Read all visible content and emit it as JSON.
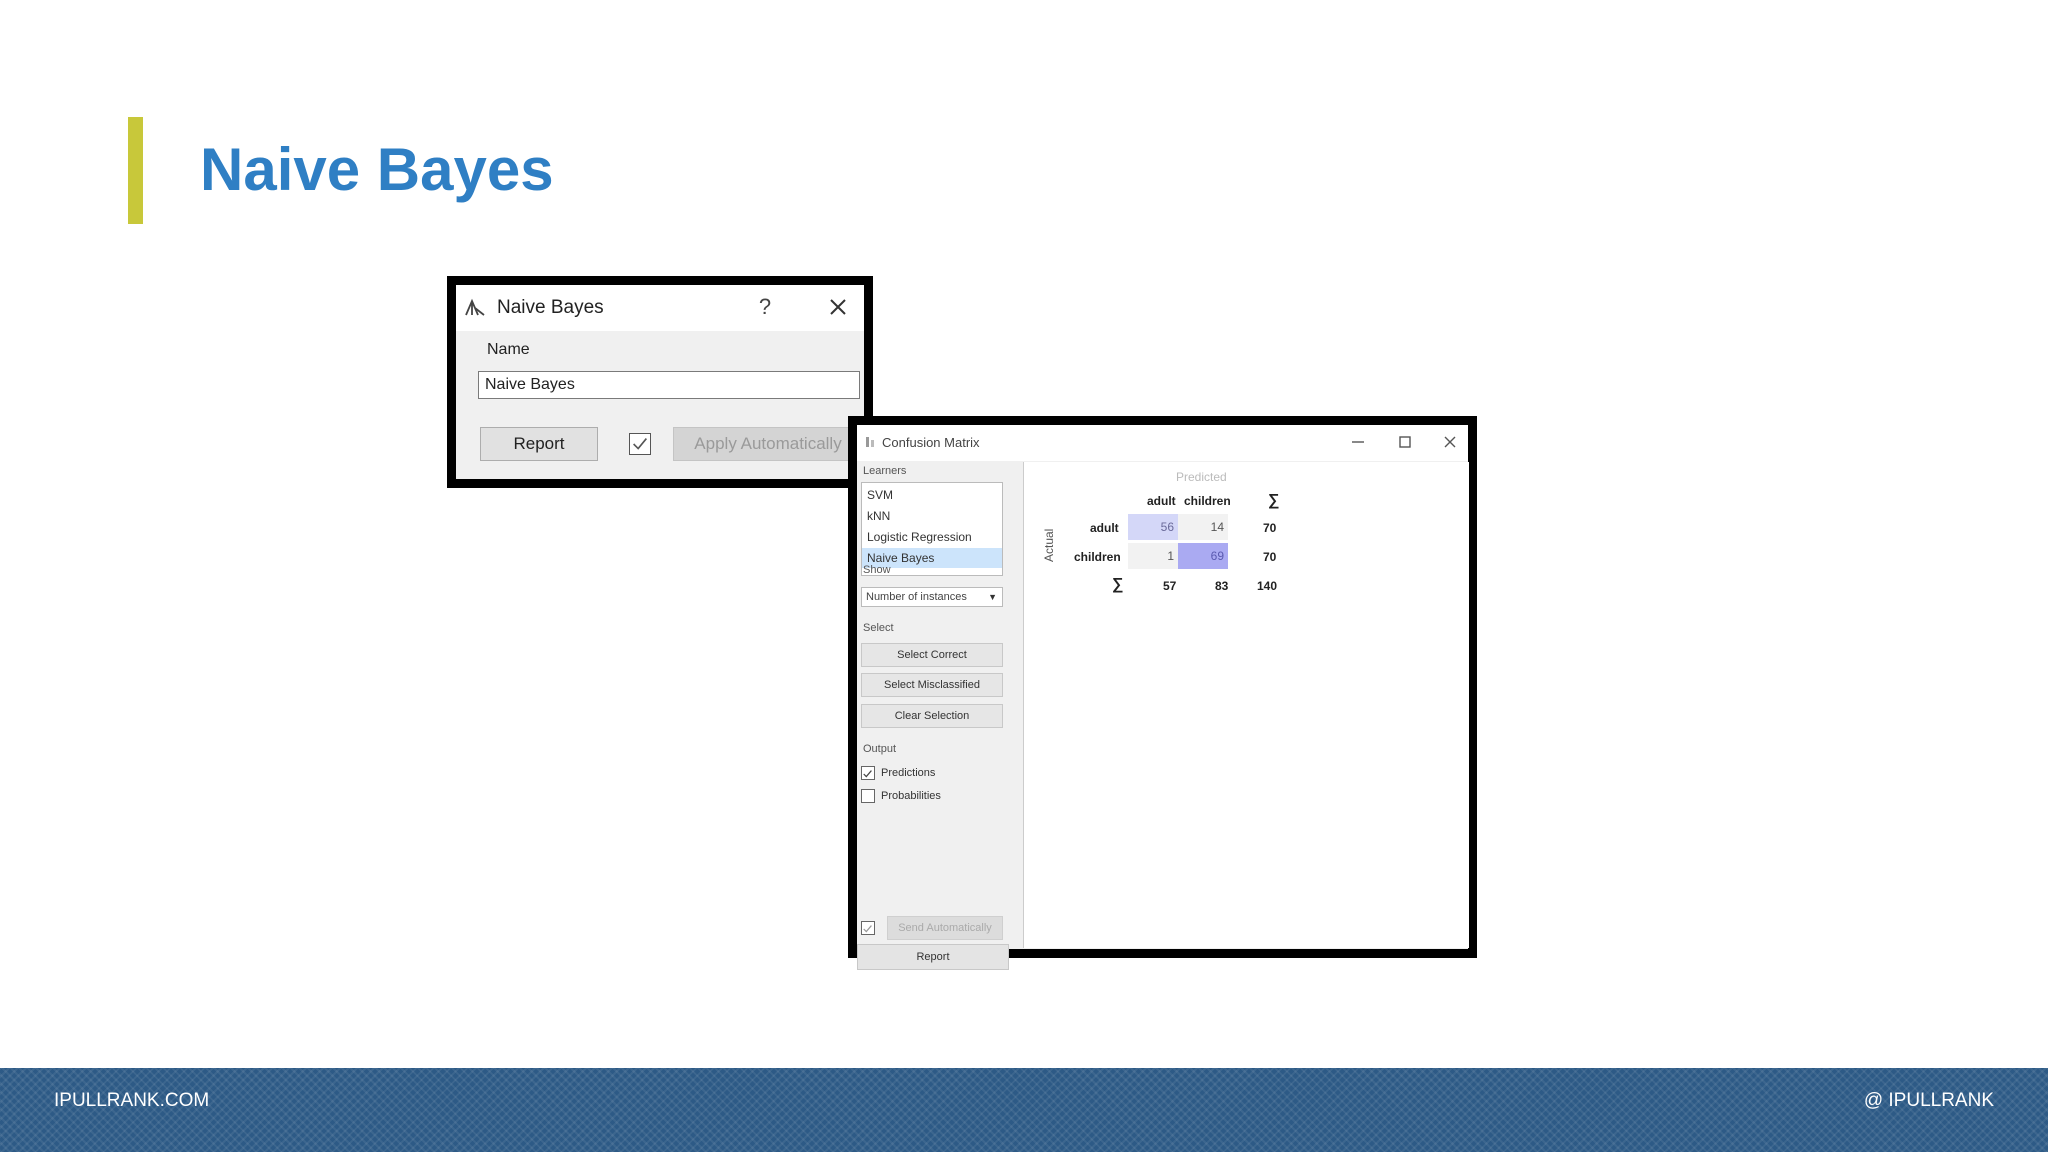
{
  "slide": {
    "title": "Naive Bayes",
    "accent_color": "#c8c83a",
    "title_color": "#2f7fc4"
  },
  "nb_widget": {
    "title": "Naive Bayes",
    "help_label": "?",
    "name_label": "Name",
    "name_value": "Naive Bayes",
    "report_label": "Report",
    "apply_auto_checked": true,
    "apply_auto_label": "Apply Automatically",
    "icons": [
      "naive-bayes-icon",
      "help-icon",
      "close-icon",
      "checkbox-icon"
    ]
  },
  "confusion_matrix": {
    "title": "Confusion Matrix",
    "icons": [
      "confusion-matrix-icon",
      "minimize-icon",
      "maximize-icon",
      "close-icon"
    ],
    "learners_label": "Learners",
    "learners": [
      "SVM",
      "kNN",
      "Logistic Regression",
      "Naive Bayes"
    ],
    "selected_learner": "Naive Bayes",
    "show_label": "Show",
    "show_value": "Number of instances",
    "select_label": "Select",
    "select_correct": "Select Correct",
    "select_misclassified": "Select Misclassified",
    "clear_selection": "Clear Selection",
    "output_label": "Output",
    "predictions_label": "Predictions",
    "predictions_checked": true,
    "probabilities_label": "Probabilities",
    "probabilities_checked": false,
    "send_auto_checked": true,
    "send_auto_label": "Send Automatically",
    "report_label": "Report",
    "matrix": {
      "predicted_label": "Predicted",
      "actual_label": "Actual",
      "sum_symbol": "∑",
      "col_headers": [
        "adult",
        "children"
      ],
      "row_headers": [
        "adult",
        "children"
      ],
      "rows": [
        {
          "cells": [
            "56",
            "14"
          ],
          "total": "70"
        },
        {
          "cells": [
            "1",
            "69"
          ],
          "total": "70"
        }
      ],
      "col_totals": [
        "57",
        "83"
      ],
      "grand_total": "140",
      "colors": {
        "diag_light": "#d4d7f8",
        "diag_strong": "#aaaaf2",
        "off_diag": "#f2f2f2"
      }
    }
  },
  "footer": {
    "left": "IPULLRANK.COM",
    "right": "@ IPULLRANK",
    "background": "#2d5a86"
  }
}
